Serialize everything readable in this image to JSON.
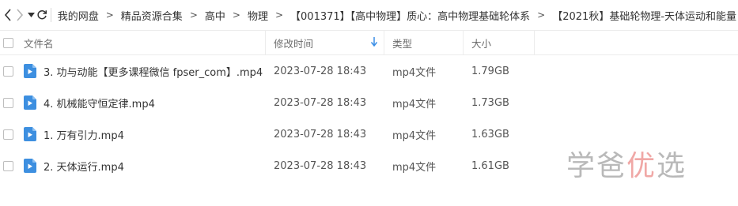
{
  "toolbar": {
    "back_icon": "chevron-left-icon",
    "forward_icon": "chevron-right-icon",
    "dropdown_icon": "caret-down-icon",
    "refresh_icon": "refresh-icon",
    "breadcrumb": [
      "我的网盘",
      "精品资源合集",
      "高中",
      "物理",
      "【001371】【高中物理】质心：高中物理基础轮体系",
      "【2021秋】基础轮物理-天体运动和能量"
    ]
  },
  "table": {
    "headers": {
      "name": "文件名",
      "date": "修改时间",
      "type": "类型",
      "size": "大小"
    },
    "sort_icon": "sort-down-arrow-icon",
    "rows": [
      {
        "name": "3. 功与动能【更多课程微信 fpser_com】.mp4",
        "date": "2023-07-28 18:43",
        "type": "mp4文件",
        "size": "1.79GB"
      },
      {
        "name": "4. 机械能守恒定律.mp4",
        "date": "2023-07-28 18:43",
        "type": "mp4文件",
        "size": "1.73GB"
      },
      {
        "name": "1. 万有引力.mp4",
        "date": "2023-07-28 18:43",
        "type": "mp4文件",
        "size": "1.63GB"
      },
      {
        "name": "2. 天体运行.mp4",
        "date": "2023-07-28 18:43",
        "type": "mp4文件",
        "size": "1.61GB"
      }
    ]
  },
  "watermark": {
    "part1": "学爸",
    "accent": "优",
    "part2": "选"
  },
  "colors": {
    "video_icon": "#3d8fe0",
    "sort_arrow": "#3a8ee6",
    "watermark_gray": "#b9b9b9",
    "watermark_accent": "#f0a8a6"
  }
}
